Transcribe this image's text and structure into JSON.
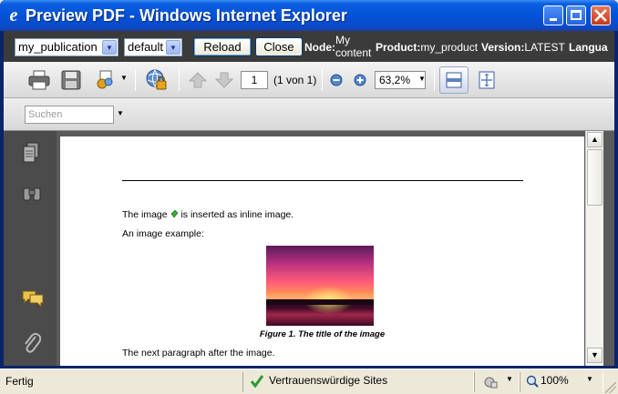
{
  "window": {
    "title": "Preview PDF - Windows Internet Explorer",
    "title_icon": "ie-logo-icon"
  },
  "topbar": {
    "publication_select": "my_publication",
    "language_select": "default",
    "reload_label": "Reload",
    "close_label": "Close",
    "node_label": "Node:",
    "node_value_line1": "My",
    "node_value_line2": "content",
    "product_label": "Product:",
    "product_value": "my_product",
    "version_label": "Version:",
    "version_value": "LATEST",
    "language_label": "Langua"
  },
  "pdf_toolbar": {
    "page_number": "1",
    "page_count": "(1 von 1)",
    "zoom": "63,2%",
    "search_placeholder": "Suchen"
  },
  "document": {
    "line1_before": "The image ",
    "line1_after": " is inserted as inline image.",
    "line2": "An image example:",
    "caption": "Figure 1. The title of the image",
    "line4": "The next paragraph after the image."
  },
  "statusbar": {
    "status": "Fertig",
    "zone": "Vertrauenswürdige Sites",
    "zoom": "100%"
  },
  "colors": {
    "titlebar": "#0353d8",
    "topbar": "#3b3b3b",
    "viewer_bg": "#5a5a5a",
    "sidebar": "#4b4b4b"
  }
}
